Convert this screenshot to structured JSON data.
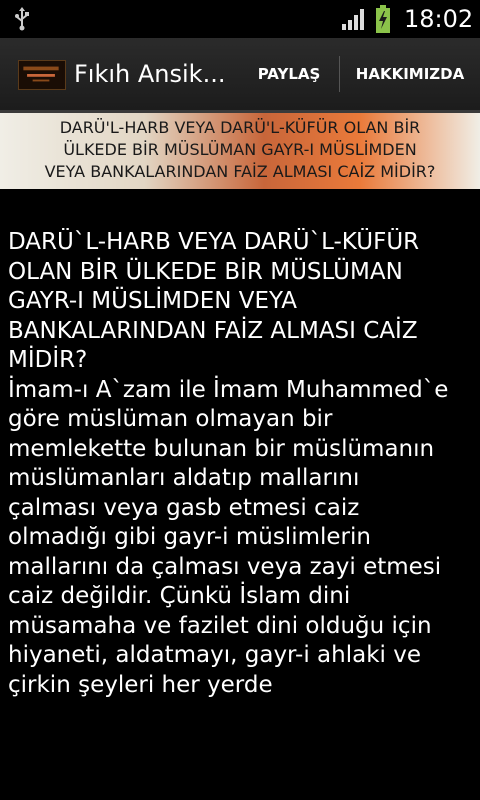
{
  "status_bar": {
    "time": "18:02",
    "icons": [
      "usb-icon",
      "signal-icon",
      "battery-charging-icon"
    ],
    "battery_color": "#8bc34a"
  },
  "action_bar": {
    "title": "Fıkıh Ansik...",
    "share_label": "PAYLAŞ",
    "about_label": "HAKKIMIZDA"
  },
  "banner": {
    "lines": [
      "DARÜ'L-HARB VEYA DARÜ'L-KÜFÜR OLAN BİR",
      "ÜLKEDE BİR MÜSLÜMAN GAYR-I MÜSLİMDEN",
      "VEYA BANKALARINDAN FAİZ ALMASI CAİZ MİDİR?"
    ]
  },
  "article": {
    "lines": [
      "DARÜ`L-HARB VEYA DARÜ`L-KÜFÜR",
      "OLAN BİR ÜLKEDE BİR MÜSLÜMAN",
      "GAYR-I MÜSLİMDEN VEYA",
      "BANKALARINDAN FAİZ ALMASI CAİZ",
      "MİDİR?",
      "İmam-ı A`zam ile İmam Muhammed`e",
      "göre müslüman olmayan bir",
      "memlekette bulunan bir müslümanın",
      "müslümanları aldatıp mallarını",
      "çalması veya gasb etmesi caiz",
      "olmadığı gibi gayr-i müslimlerin",
      "mallarını da çalması veya zayi etmesi",
      "caiz değildir. Çünkü İslam dini",
      "müsamaha ve fazilet dini olduğu için",
      "hiyaneti, aldatmayı, gayr-i ahlaki ve",
      "çirkin şeyleri her yerde"
    ]
  }
}
